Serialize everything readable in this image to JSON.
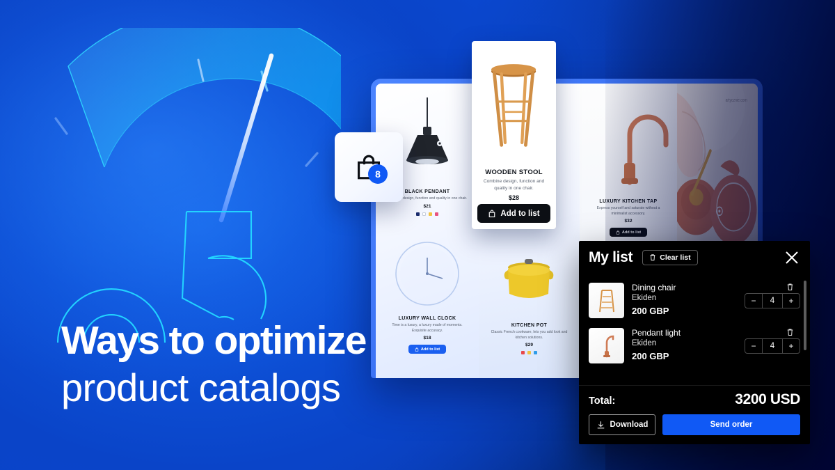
{
  "colors": {
    "bg_blue": "#0540bf",
    "bg_navy": "#000640",
    "accent_blue": "#1059f5",
    "gauge_cyan": "#18d7ff",
    "numeral_cyan": "#22d3ff",
    "panel_black": "#000000"
  },
  "hero": {
    "numeral": "05",
    "headline_line1": "Ways to optimize",
    "headline_line2": "product catalogs"
  },
  "cart": {
    "icon": "shopping-bag-icon",
    "badge_count": "8"
  },
  "featured_product": {
    "title": "WOODEN STOOL",
    "description": "Combine design, function and quality in one chair.",
    "price": "$28",
    "button_label": "Add to list",
    "button_icon": "shopping-bag-icon"
  },
  "catalog_products": [
    {
      "title": "BLACK PENDANT",
      "description": "Combine design, function and quality in one chair.",
      "price": "$21",
      "swatches": [
        "#1b2c6e",
        "#ffffff",
        "#f2c341",
        "#e8527f"
      ],
      "button_label": "",
      "has_button": false
    },
    {
      "title": "LUXURY KITCHEN TAP",
      "description": "Express yourself and saturate without a minimalist accessory.",
      "price": "$32",
      "swatches": [],
      "button_label": "Add to list",
      "has_button": true
    },
    {
      "title": "LUXURY WALL CLOCK",
      "description": "Time is a luxury, a luxury made of moments. Exquisite accuracy.",
      "price": "$18",
      "swatches": [],
      "button_label": "Add to list",
      "has_button": true
    },
    {
      "title": "KITCHEN POT",
      "description": "Classic French cookware, lets you add look and kitchen solutions.",
      "price": "$29",
      "swatches": [
        "#e8484a",
        "#f2c341",
        "#2f9ce8"
      ],
      "button_label": "",
      "has_button": false
    }
  ],
  "my_list": {
    "title": "My list",
    "clear_label": "Clear list",
    "clear_icon": "trash-icon",
    "close_icon": "close-icon",
    "items": [
      {
        "name": "Dining chair",
        "brand": "Ekiden",
        "price": "200 GBP",
        "quantity": "4",
        "minus_label": "−",
        "plus_label": "+",
        "remove_icon": "trash-icon",
        "thumb": "dining-chair-thumb"
      },
      {
        "name": "Pendant light",
        "brand": "Ekiden",
        "price": "200 GBP",
        "quantity": "4",
        "minus_label": "−",
        "plus_label": "+",
        "remove_icon": "trash-icon",
        "thumb": "pendant-light-thumb"
      }
    ],
    "total_label": "Total:",
    "total_value": "3200 USD",
    "download_label": "Download",
    "download_icon": "download-icon",
    "send_label": "Send order"
  }
}
